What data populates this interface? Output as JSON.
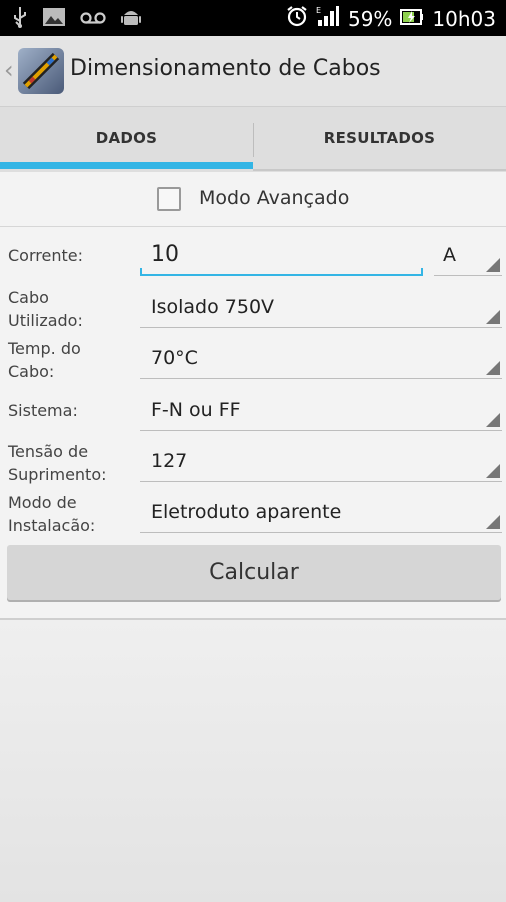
{
  "status_bar": {
    "battery": "59%",
    "time": "10h03",
    "icons": [
      "usb-icon",
      "image-icon",
      "voicemail-icon",
      "android-icon",
      "alarm-icon",
      "signal-icon",
      "battery-icon"
    ]
  },
  "action_bar": {
    "title": "Dimensionamento de Cabos",
    "back_icon": "chevron-left-icon",
    "app_icon": "cable-app-icon"
  },
  "tabs": [
    {
      "label": "DADOS",
      "selected": true
    },
    {
      "label": "RESULTADOS",
      "selected": false
    }
  ],
  "colors": {
    "accent": "#33b5e5"
  },
  "form": {
    "advanced_mode_label": "Modo Avançado",
    "advanced_mode_checked": false,
    "corrente": {
      "label": "Corrente:",
      "value": "10",
      "unit": "A"
    },
    "cabo": {
      "label_1": "Cabo",
      "label_2": "Utilizado:",
      "value": "Isolado 750V"
    },
    "temp": {
      "label_1": "Temp. do",
      "label_2": "Cabo:",
      "value": "70°C"
    },
    "sistema": {
      "label_1": "Sistema:",
      "value": "F-N ou FF"
    },
    "tensao": {
      "label_1": "Tensão de",
      "label_2": "Suprimento:",
      "value": "127"
    },
    "modo": {
      "label_1": "Modo de",
      "label_2": "Instalacão:",
      "value": "Eletroduto aparente"
    },
    "calc_button": "Calcular"
  }
}
